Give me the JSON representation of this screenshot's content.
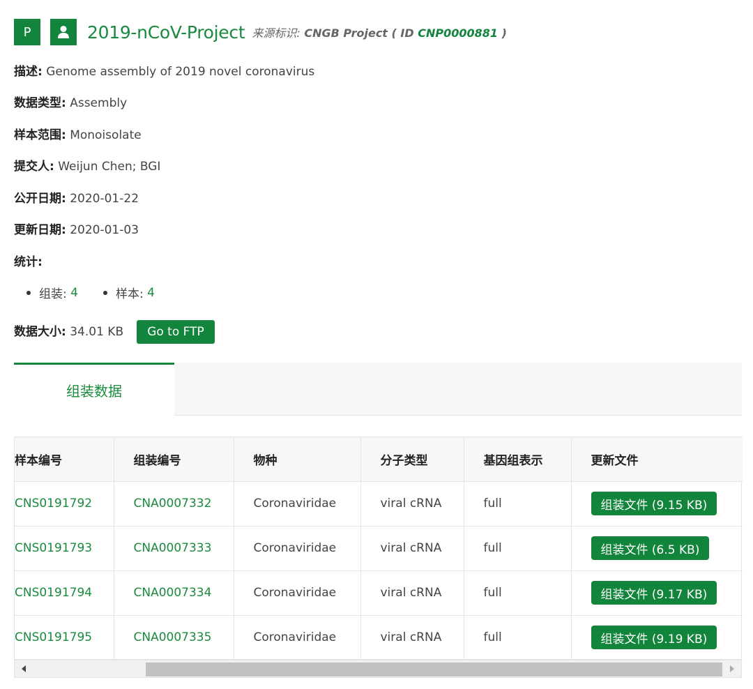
{
  "header": {
    "badge_letter": "P",
    "title": "2019-nCoV-Project",
    "source_label": "来源标识:",
    "source_name": "CNGB Project",
    "id_prefix": "( ID",
    "id_value": "CNP0000881",
    "id_suffix": ")"
  },
  "fields": [
    {
      "key": "描述",
      "value": "Genome assembly of 2019 novel coronavirus"
    },
    {
      "key": "数据类型",
      "value": "Assembly"
    },
    {
      "key": "样本范围",
      "value": "Monoisolate"
    },
    {
      "key": "提交人",
      "value": "Weijun Chen; BGI"
    },
    {
      "key": "公开日期",
      "value": "2020-01-22"
    },
    {
      "key": "更新日期",
      "value": "2020-01-03"
    },
    {
      "key": "统计",
      "value": ""
    }
  ],
  "stats": [
    {
      "label": "组装:",
      "count": "4"
    },
    {
      "label": "样本:",
      "count": "4"
    }
  ],
  "data_size": {
    "key": "数据大小",
    "value": "34.01 KB",
    "ftp_label": "Go to FTP"
  },
  "tabs": [
    {
      "label": "组装数据",
      "active": true
    }
  ],
  "table": {
    "headers": [
      "样本编号",
      "组装编号",
      "物种",
      "分子类型",
      "基因组表示",
      "更新文件"
    ],
    "rows": [
      {
        "sample": "CNS0191792",
        "assembly": "CNA0007332",
        "species": "Coronaviridae",
        "molecule": "viral cRNA",
        "genome": "full",
        "file": "组装文件 (9.15 KB)"
      },
      {
        "sample": "CNS0191793",
        "assembly": "CNA0007333",
        "species": "Coronaviridae",
        "molecule": "viral cRNA",
        "genome": "full",
        "file": "组装文件 (6.5 KB)"
      },
      {
        "sample": "CNS0191794",
        "assembly": "CNA0007334",
        "species": "Coronaviridae",
        "molecule": "viral cRNA",
        "genome": "full",
        "file": "组装文件 (9.17 KB)"
      },
      {
        "sample": "CNS0191795",
        "assembly": "CNA0007335",
        "species": "Coronaviridae",
        "molecule": "viral cRNA",
        "genome": "full",
        "file": "组装文件 (9.19 KB)"
      }
    ]
  },
  "colors": {
    "accent": "#12843c",
    "link": "#1a8a3e"
  },
  "icons": {
    "user_badge": "user-icon",
    "scroll_left": "arrow-left-icon",
    "scroll_right": "arrow-right-icon"
  }
}
